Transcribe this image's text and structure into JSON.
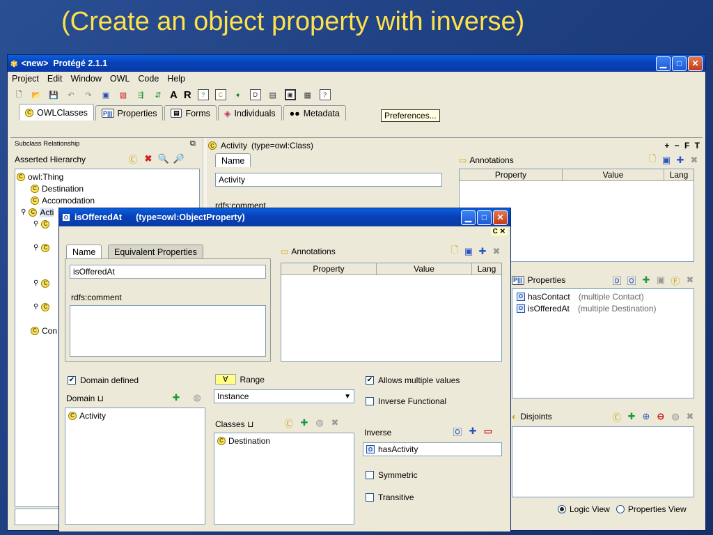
{
  "slide": {
    "title": "(Create an object property with inverse)"
  },
  "main_window": {
    "title": "<new>  Protégé 2.1.1",
    "menu": [
      "Project",
      "Edit",
      "Window",
      "OWL",
      "Code",
      "Help"
    ],
    "toolbar_text": {
      "a": "A",
      "r": "R"
    },
    "tooltip": "Preferences...",
    "tabs": [
      {
        "label": "OWLClasses",
        "icon": "C"
      },
      {
        "label": "Properties",
        "icon": "P"
      },
      {
        "label": "Forms",
        "icon": "F"
      },
      {
        "label": "Individuals",
        "icon": "I"
      },
      {
        "label": "Metadata",
        "icon": "M"
      }
    ],
    "left": {
      "subclass_label": "Subclass Relationship",
      "asserted_label": "Asserted Hierarchy",
      "tree": [
        {
          "label": "owl:Thing",
          "level": 0
        },
        {
          "label": "Destination",
          "level": 1
        },
        {
          "label": "Accomodation",
          "level": 1
        },
        {
          "label": "Acti",
          "level": 1
        },
        {
          "label": "Con",
          "level": 1
        }
      ]
    },
    "class_header": {
      "label": "Activity",
      "type": "(type=owl:Class)",
      "icons_right": "+ − F T"
    },
    "class_form": {
      "name_tab": "Name",
      "name_value": "Activity",
      "rdfs_comment": "rdfs:comment"
    },
    "annotations": {
      "label": "Annotations",
      "columns": [
        "Property",
        "Value",
        "Lang"
      ]
    },
    "properties": {
      "label": "Properties",
      "items": [
        {
          "name": "hasContact",
          "detail": "(multiple Contact)"
        },
        {
          "name": "isOfferedAt",
          "detail": "(multiple Destination)"
        }
      ]
    },
    "disjoints": {
      "label": "Disjoints"
    },
    "view": {
      "logic": "Logic View",
      "properties": "Properties View",
      "selected": "logic"
    }
  },
  "dialog": {
    "title": "isOfferedAt",
    "type": "(type=owl:ObjectProperty)",
    "corner": "C ✕",
    "tabs": [
      "Name",
      "Equivalent Properties"
    ],
    "name_value": "isOfferedAt",
    "rdfs_comment": "rdfs:comment",
    "annotations": {
      "label": "Annotations",
      "columns": [
        "Property",
        "Value",
        "Lang"
      ]
    },
    "domain_defined": {
      "label": "Domain defined",
      "checked": true
    },
    "domain_label": "Domain ⊔",
    "domain_items": [
      "Activity"
    ],
    "range": {
      "label": "Range",
      "value": "Instance"
    },
    "classes_label": "Classes ⊔",
    "classes_items": [
      "Destination"
    ],
    "allows_multiple": {
      "label": "Allows multiple values",
      "checked": true
    },
    "inverse_functional": {
      "label": "Inverse Functional",
      "checked": false
    },
    "inverse_label": "Inverse",
    "inverse_value": "hasActivity",
    "symmetric": {
      "label": "Symmetric",
      "checked": false
    },
    "transitive": {
      "label": "Transitive",
      "checked": false
    }
  }
}
